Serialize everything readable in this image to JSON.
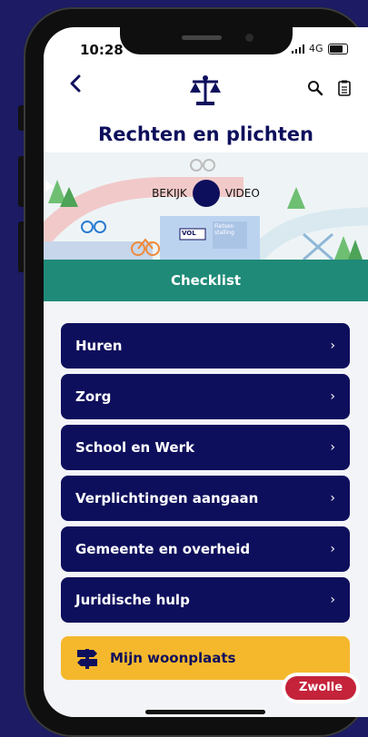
{
  "status": {
    "time": "10:28",
    "network": "4G"
  },
  "nav": {
    "back_icon": "chevron-left-icon",
    "logo_icon": "scales-icon",
    "search_icon": "search-icon",
    "list_icon": "checklist-icon"
  },
  "title": "Rechten en plichten",
  "hero": {
    "watch_label": "BEKIJK",
    "video_label": "VIDEO",
    "sign_vol": "VOL",
    "sign_station": "Fietsen stalling"
  },
  "section_title": "Checklist",
  "items": [
    {
      "label": "Huren"
    },
    {
      "label": "Zorg"
    },
    {
      "label": "School en Werk"
    },
    {
      "label": "Verplichtingen aangaan"
    },
    {
      "label": "Gemeente en overheid"
    },
    {
      "label": "Juridische hulp"
    }
  ],
  "woonplaats": {
    "label": "Mijn woonplaats",
    "icon": "signpost-icon"
  },
  "city_badge": "Zwolle",
  "colors": {
    "navy": "#0e0f5c",
    "teal": "#1f8a78",
    "yellow": "#f5b82d",
    "red": "#c4233a",
    "background": "#1c1b63"
  }
}
